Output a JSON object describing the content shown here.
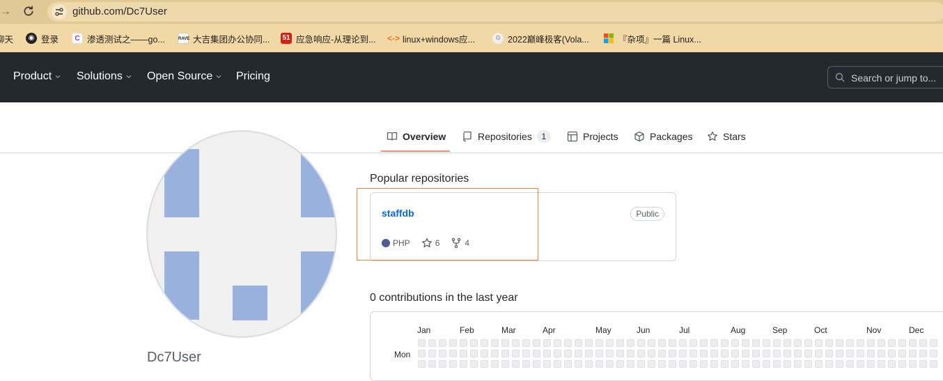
{
  "browser": {
    "url": "github.com/Dc7User",
    "bookmarks": [
      {
        "label": "聊天",
        "icon": "none"
      },
      {
        "label": "登录",
        "icon": "globe-icon"
      },
      {
        "label": "渗透测试之——go...",
        "icon": "c-logo-icon"
      },
      {
        "label": "大吉集团办公协同...",
        "icon": "rave-logo-icon"
      },
      {
        "label": "应急响应-从理论到...",
        "icon": "51-logo-icon"
      },
      {
        "label": "linux+windows应...",
        "icon": "code-bracket-icon"
      },
      {
        "label": "2022巅峰极客(Vola...",
        "icon": "avatar-face-icon"
      },
      {
        "label": "『杂项』一篇 Linux...",
        "icon": "windows-logo-icon"
      }
    ]
  },
  "header": {
    "nav": [
      "Product",
      "Solutions",
      "Open Source",
      "Pricing"
    ],
    "search_placeholder": "Search or jump to..."
  },
  "tabs": [
    {
      "label": "Overview",
      "icon": "book-icon",
      "active": true
    },
    {
      "label": "Repositories",
      "icon": "repo-icon",
      "count": "1"
    },
    {
      "label": "Projects",
      "icon": "table-icon"
    },
    {
      "label": "Packages",
      "icon": "package-icon"
    },
    {
      "label": "Stars",
      "icon": "star-icon"
    }
  ],
  "profile": {
    "username": "Dc7User"
  },
  "popular": {
    "title": "Popular repositories",
    "repos": [
      {
        "name": "staffdb",
        "visibility": "Public",
        "language": "PHP",
        "language_color": "#4F5D95",
        "stars": "6",
        "forks": "4"
      }
    ]
  },
  "contributions": {
    "title": "0 contributions in the last year",
    "months": [
      "Jan",
      "Feb",
      "Mar",
      "Apr",
      "May",
      "Jun",
      "Jul",
      "Aug",
      "Sep",
      "Oct",
      "Nov",
      "Dec"
    ],
    "day_label": "Mon"
  },
  "colors": {
    "header_bg": "#24292f",
    "link": "#0969da",
    "tab_underline": "#fd8c73",
    "highlight_box": "#e8853d",
    "avatar_blocks": "#98b2dd"
  }
}
